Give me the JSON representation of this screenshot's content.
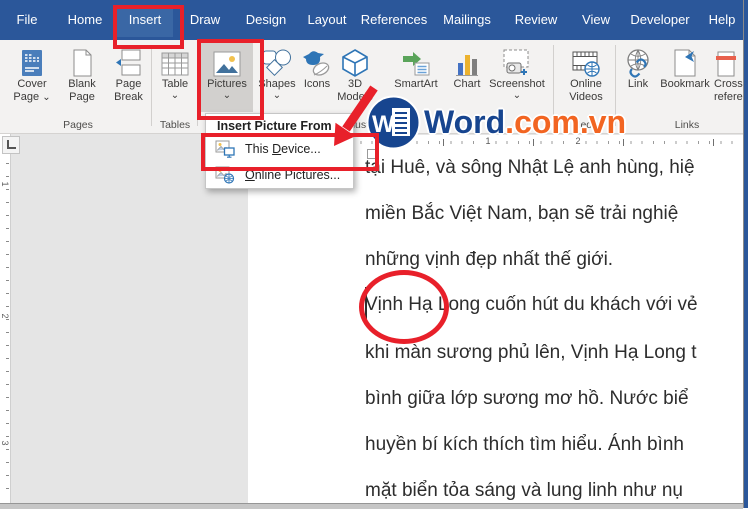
{
  "colors": {
    "accent": "#2b579a",
    "annotation_red": "#e8202a",
    "watermark_blue": "#17458f",
    "watermark_orange": "#f26522"
  },
  "menu_bar": {
    "active_tab": "Insert",
    "tabs": [
      {
        "label": "File"
      },
      {
        "label": "Home"
      },
      {
        "label": "Insert"
      },
      {
        "label": "Draw"
      },
      {
        "label": "Design"
      },
      {
        "label": "Layout"
      },
      {
        "label": "References"
      },
      {
        "label": "Mailings"
      },
      {
        "label": "Review"
      },
      {
        "label": "View"
      },
      {
        "label": "Developer"
      },
      {
        "label": "Help"
      }
    ]
  },
  "ribbon": {
    "groups": {
      "pages": "Pages",
      "tables": "Tables",
      "illustrations": "Illustrations",
      "media": "Media",
      "links": "Links"
    },
    "buttons": [
      {
        "line1": "Cover",
        "line2": "Page"
      },
      {
        "line1": "Blank",
        "line2": "Page"
      },
      {
        "line1": "Page",
        "line2": "Break"
      },
      {
        "line1": "Table"
      },
      {
        "line1": "Pictures"
      },
      {
        "line1": "Shapes"
      },
      {
        "line1": "Icons"
      },
      {
        "line1": "3D",
        "line2": "Models"
      },
      {
        "line1": "SmartArt"
      },
      {
        "line1": "Chart"
      },
      {
        "line1": "Screenshot"
      },
      {
        "line1": "Online",
        "line2": "Videos"
      },
      {
        "line1": "Link"
      },
      {
        "line1": "Bookmark"
      },
      {
        "line1": "Cross-",
        "line2": "reference"
      }
    ],
    "icon_names": [
      "cover-page-icon",
      "blank-page-icon",
      "page-break-icon",
      "table-icon",
      "pictures-icon",
      "shapes-icon",
      "icons-bird-icon",
      "3d-models-icon",
      "smartart-icon",
      "chart-icon",
      "screenshot-icon",
      "online-videos-icon",
      "link-icon",
      "bookmark-icon",
      "cross-reference-icon"
    ]
  },
  "dropdown": {
    "header": "Insert Picture From",
    "items": [
      {
        "pre": "This ",
        "key": "D",
        "post": "evice..."
      },
      {
        "pre": "",
        "key": "O",
        "post": "nline Pictures..."
      }
    ]
  },
  "watermark": {
    "initial": "W",
    "name": "Word",
    "domain": ".com.vn"
  },
  "rulers": {
    "h": [
      "1",
      "2"
    ],
    "v": [
      "1",
      "2",
      "3"
    ]
  },
  "document": {
    "lines": [
      "tại Huê, và sông Nhật Lệ anh hùng, hiệ",
      "miền Bắc Việt Nam, bạn sẽ trải nghiệ",
      "những vịnh đẹp nhất thế giới.",
      "Vịnh Hạ Long cuốn hút du khách với vẻ",
      "khi màn sương phủ lên, Vịnh Hạ Long t",
      "bình giữa lớp sương mơ hồ. Nước biể",
      "huyền bí kích thích tìm hiểu. Ánh bình",
      "mặt biển tỏa sáng và lung linh như nụ"
    ],
    "circled_word": "Vịnh"
  }
}
